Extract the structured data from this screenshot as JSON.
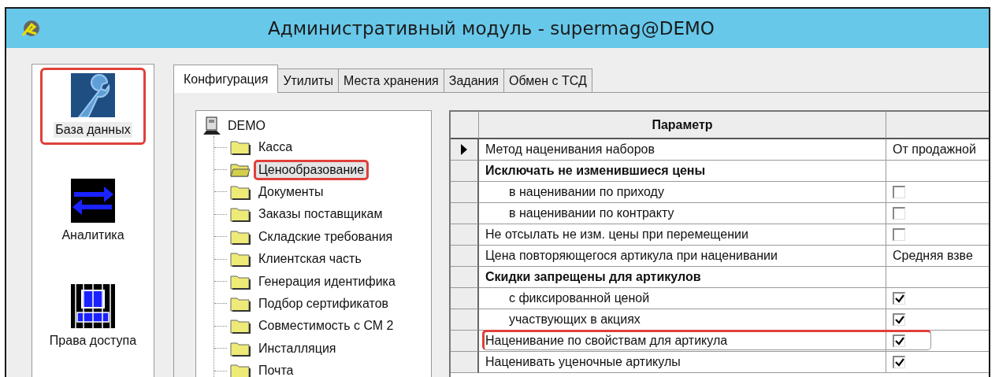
{
  "window": {
    "title": "Административный модуль - supermag@DEMO"
  },
  "sidebar": {
    "items": [
      {
        "label": "База данных",
        "selected": true,
        "highlighted": true
      },
      {
        "label": "Аналитика",
        "selected": false,
        "highlighted": false
      },
      {
        "label": "Права доступа",
        "selected": false,
        "highlighted": false
      }
    ]
  },
  "tabs": [
    {
      "label": "Конфигурация",
      "selected": true
    },
    {
      "label": "Утилиты",
      "selected": false
    },
    {
      "label": "Места хранения",
      "selected": false
    },
    {
      "label": "Задания",
      "selected": false
    },
    {
      "label": "Обмен с ТСД",
      "selected": false
    }
  ],
  "tree": {
    "label": "DEMO",
    "children": [
      {
        "label": "Касса",
        "selected": false,
        "highlighted": false
      },
      {
        "label": "Ценообразование",
        "selected": true,
        "highlighted": true
      },
      {
        "label": "Документы",
        "selected": false,
        "highlighted": false
      },
      {
        "label": "Заказы поставщикам",
        "selected": false,
        "highlighted": false
      },
      {
        "label": "Складские требования",
        "selected": false,
        "highlighted": false
      },
      {
        "label": "Клиентская часть",
        "selected": false,
        "highlighted": false
      },
      {
        "label": "Генерация идентифика",
        "selected": false,
        "highlighted": false
      },
      {
        "label": "Подбор сертификатов",
        "selected": false,
        "highlighted": false
      },
      {
        "label": "Совместимость с СМ 2",
        "selected": false,
        "highlighted": false
      },
      {
        "label": "Инсталляция",
        "selected": false,
        "highlighted": false
      },
      {
        "label": "Почта",
        "selected": false,
        "highlighted": false
      }
    ]
  },
  "grid": {
    "columns": [
      {
        "label": "Параметр"
      }
    ],
    "rows": [
      {
        "kind": "text",
        "parameter": "Метод наценивания наборов",
        "value": "От продажной",
        "selected": true,
        "highlighted": false
      },
      {
        "kind": "group",
        "parameter": "Исключать не изменившиеся цены",
        "selected": false,
        "highlighted": false,
        "children": [
          {
            "kind": "checkbox",
            "parameter": "в наценивании по приходу",
            "checked": false,
            "selected": false,
            "highlighted": false
          },
          {
            "kind": "checkbox",
            "parameter": "в наценивании по контракту",
            "checked": false,
            "selected": false,
            "highlighted": false
          }
        ]
      },
      {
        "kind": "checkbox",
        "parameter": "Не отсылать не изм. цены при перемещении",
        "checked": false,
        "selected": false,
        "highlighted": false
      },
      {
        "kind": "text",
        "parameter": "Цена повторяющегося артикула при наценивании",
        "value": "Средняя взве",
        "selected": false,
        "highlighted": false
      },
      {
        "kind": "group",
        "parameter": "Скидки запрещены для артикулов",
        "selected": false,
        "highlighted": false,
        "children": [
          {
            "kind": "checkbox",
            "parameter": "с фиксированной ценой",
            "checked": true,
            "selected": false,
            "highlighted": false
          },
          {
            "kind": "checkbox",
            "parameter": "участвующих в акциях",
            "checked": true,
            "selected": false,
            "highlighted": false
          }
        ]
      },
      {
        "kind": "checkbox",
        "parameter": "Наценивание по свойствам для артикула",
        "checked": true,
        "selected": false,
        "highlighted": true
      },
      {
        "kind": "checkbox",
        "parameter": "Наценивать уценочные артикулы",
        "checked": true,
        "selected": false,
        "highlighted": false
      }
    ]
  }
}
